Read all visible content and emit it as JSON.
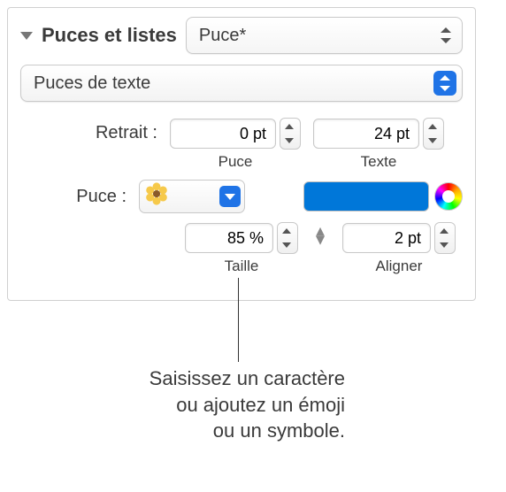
{
  "header": {
    "title": "Puces et listes",
    "style": "Puce*"
  },
  "type_popup": "Puces de texte",
  "indent": {
    "label": "Retrait :",
    "bullet": {
      "value": "0 pt",
      "caption": "Puce"
    },
    "text": {
      "value": "24 pt",
      "caption": "Texte"
    }
  },
  "bullet": {
    "label": "Puce :",
    "emoji": "flower",
    "color": "#0077d9"
  },
  "size": {
    "value": "85 %",
    "caption": "Taille"
  },
  "align": {
    "value": "2 pt",
    "caption": "Aligner"
  },
  "callout": {
    "l1": "Saisissez un caractère",
    "l2": "ou ajoutez un émoji",
    "l3": "ou un symbole."
  }
}
